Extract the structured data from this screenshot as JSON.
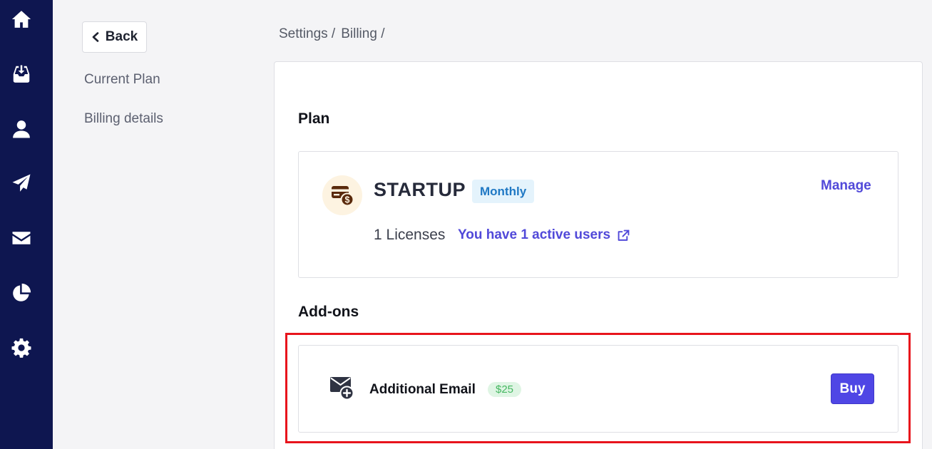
{
  "nav": {
    "icons": [
      "home-icon",
      "inbox-download-icon",
      "user-icon",
      "send-icon",
      "mail-icon",
      "pie-chart-icon",
      "settings-gear-icon"
    ]
  },
  "sidebar": {
    "back_label": "Back",
    "links": [
      "Current Plan",
      "Billing details"
    ]
  },
  "breadcrumb": {
    "items": [
      "Settings /",
      "Billing /"
    ]
  },
  "plan": {
    "section_title": "Plan",
    "name": "STARTUP",
    "period_badge": "Monthly",
    "manage_label": "Manage",
    "licenses_text": "1 Licenses",
    "active_users_link": "You have 1 active users"
  },
  "addons": {
    "section_title": "Add-ons",
    "items": [
      {
        "name": "Additional Email",
        "price": "$25",
        "button_label": "Buy"
      }
    ]
  },
  "colors": {
    "rail": "#0e1650",
    "accent": "#5149d9",
    "buy_button": "#4f46e5",
    "highlight": "#e8141c"
  }
}
